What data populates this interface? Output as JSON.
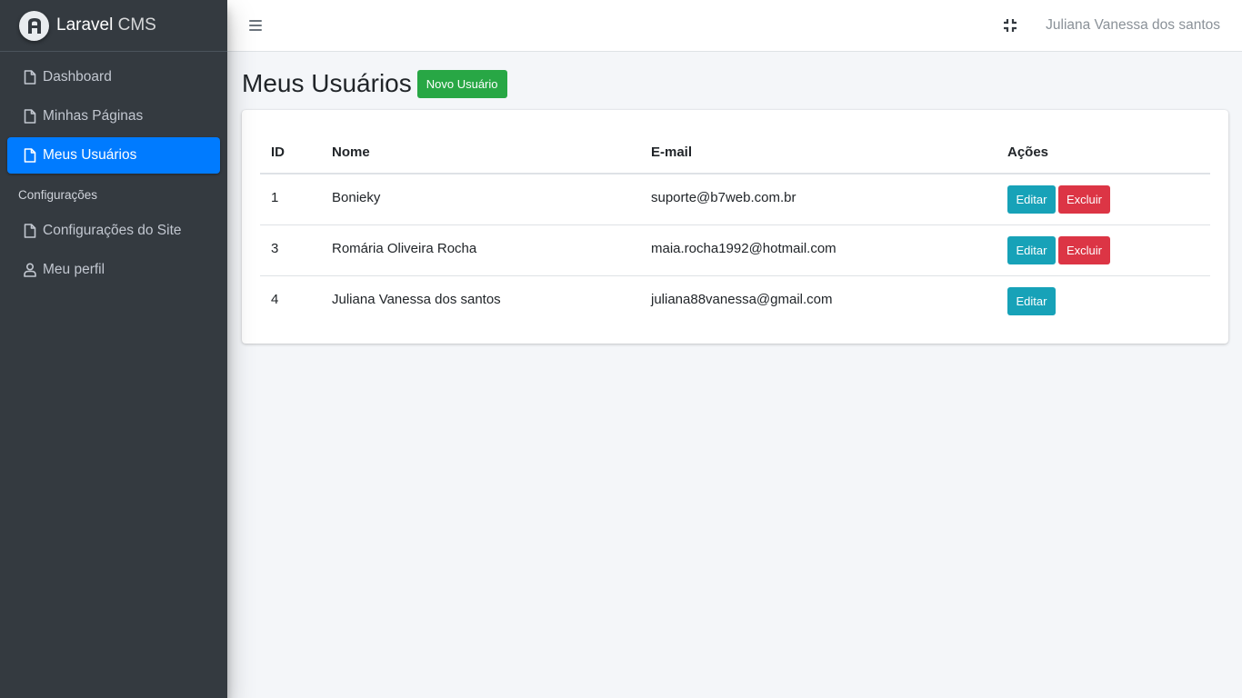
{
  "brand": {
    "name_bold": "Laravel",
    "name_light": "CMS",
    "logo_letter": "A"
  },
  "sidebar": {
    "items": [
      {
        "label": "Dashboard",
        "icon": "file-icon",
        "active": false
      },
      {
        "label": "Minhas Páginas",
        "icon": "file-icon",
        "active": false
      },
      {
        "label": "Meus Usuários",
        "icon": "file-icon",
        "active": true
      }
    ],
    "section_header": "Configurações",
    "settings_items": [
      {
        "label": "Configurações do Site",
        "icon": "file-icon"
      },
      {
        "label": "Meu perfil",
        "icon": "user-icon"
      }
    ]
  },
  "topbar": {
    "user_name": "Juliana Vanessa dos santos"
  },
  "main": {
    "title": "Meus Usuários",
    "new_user_label": "Novo Usuário",
    "table": {
      "columns": [
        "ID",
        "Nome",
        "E-mail",
        "Ações"
      ],
      "rows": [
        {
          "id": "1",
          "nome": "Bonieky",
          "email": "suporte@b7web.com.br",
          "edit_label": "Editar",
          "delete_label": "Excluir"
        },
        {
          "id": "3",
          "nome": "Romária Oliveira Rocha",
          "email": "maia.rocha1992@hotmail.com",
          "edit_label": "Editar",
          "delete_label": "Excluir"
        },
        {
          "id": "4",
          "nome": "Juliana Vanessa dos santos",
          "email": "juliana88vanessa@gmail.com",
          "edit_label": "Editar"
        }
      ]
    }
  },
  "colors": {
    "sidebar_bg": "#343a40",
    "active": "#007bff",
    "success": "#28a745",
    "info": "#17a2b8",
    "danger": "#dc3545"
  }
}
